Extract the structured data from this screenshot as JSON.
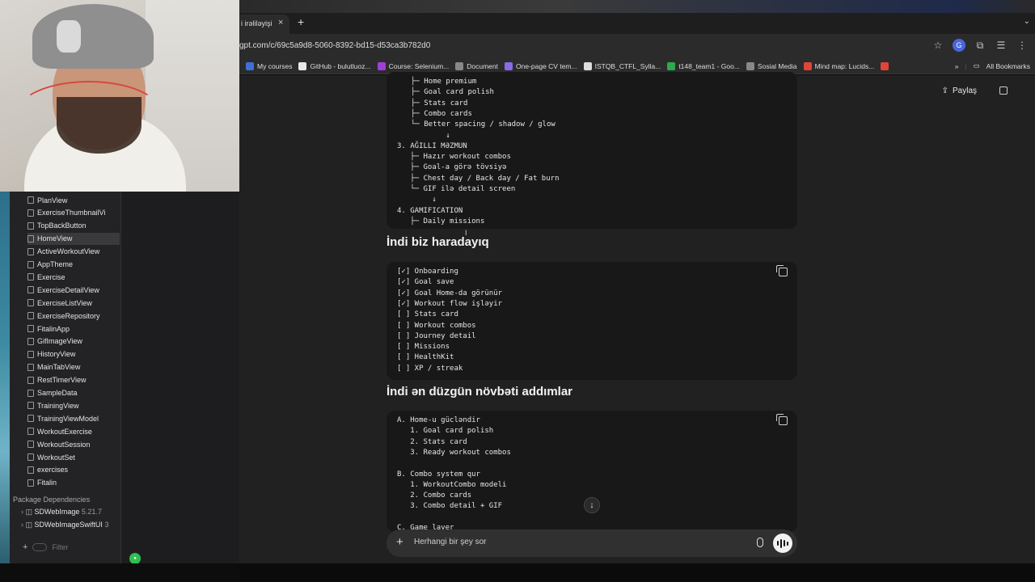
{
  "browser": {
    "tab": {
      "title": "i irəliləyişi",
      "close": "×",
      "new_tab": "+",
      "menu": "⌄"
    },
    "url": "gpt.com/c/69c5a9d8-5060-8392-bd15-d53ca3b782d0",
    "bookmarks": [
      {
        "label": "My courses",
        "color": "#3f6fd8"
      },
      {
        "label": "GitHub - bulutluoz...",
        "color": "#e8e8e8"
      },
      {
        "label": "Course: Selenium...",
        "color": "#a03fd8"
      },
      {
        "label": "Document",
        "color": "#888888"
      },
      {
        "label": "One-page CV tem...",
        "color": "#8a6be8"
      },
      {
        "label": "ISTQB_CTFL_Sylla...",
        "color": "#dddddd"
      },
      {
        "label": "t148_team1 - Goo...",
        "color": "#2fa84f"
      },
      {
        "label": "Sosial Media",
        "color": "#888888"
      },
      {
        "label": "Mind map: Lucids...",
        "color": "#e0453a"
      },
      {
        "label": "",
        "color": "#e0453a"
      }
    ],
    "bookmarks_more": "»",
    "all_bookmarks": "All Bookmarks"
  },
  "ide": {
    "files": [
      {
        "label": "PlanView"
      },
      {
        "label": "ExerciseThumbnailVi"
      },
      {
        "label": "TopBackButton"
      },
      {
        "label": "HomeView",
        "selected": true
      },
      {
        "label": "ActiveWorkoutView"
      },
      {
        "label": "AppTheme"
      },
      {
        "label": "Exercise"
      },
      {
        "label": "ExerciseDetailView"
      },
      {
        "label": "ExerciseListView"
      },
      {
        "label": "ExerciseRepository"
      },
      {
        "label": "FitalinApp"
      },
      {
        "label": "GifImageView"
      },
      {
        "label": "HistoryView"
      },
      {
        "label": "MainTabView"
      },
      {
        "label": "RestTimerView"
      },
      {
        "label": "SampleData"
      },
      {
        "label": "TrainingView"
      },
      {
        "label": "TrainingViewModel"
      },
      {
        "label": "WorkoutExercise"
      },
      {
        "label": "WorkoutSession"
      },
      {
        "label": "WorkoutSet"
      },
      {
        "label": "exercises"
      },
      {
        "label": "Fitalin"
      }
    ],
    "section_title": "Package Dependencies",
    "packages": [
      {
        "name": "SDWebImage",
        "version": "5.21.7"
      },
      {
        "name": "SDWebImageSwiftUI",
        "version": "3"
      }
    ],
    "filter_placeholder": "Filter"
  },
  "chat": {
    "share_label": "Paylaş",
    "block1_lines": [
      "├─ Home premium",
      "├─ Goal card polish",
      "├─ Stats card",
      "├─ Combo cards",
      "└─ Better spacing / shadow / glow",
      "        ↓",
      "3. AĞILLI MƏZMUN",
      "   ├─ Hazır workout combos",
      "   ├─ Goal-a görə tövsiyə",
      "   ├─ Chest day / Back day / Fat burn",
      "   └─ GIF ilə detail screen",
      "        ↓",
      "4. GAMIFICATION",
      "   ├─ Daily missions"
    ],
    "heading1": "İndi biz haradayıq",
    "block2_lines": [
      "[✓] Onboarding",
      "[✓] Goal save",
      "[✓] Goal Home-da görünür",
      "[✓] Workout flow işləyir",
      "[ ] Stats card",
      "[ ] Workout combos",
      "[ ] Journey detail",
      "[ ] Missions",
      "[ ] HealthKit",
      "[ ] XP / streak"
    ],
    "heading2": "İndi ən düzgün növbəti addımlar",
    "block3_lines": [
      "A. Home-u gücləndir",
      "   1. Goal card polish",
      "   2. Stats card",
      "   3. Ready workout combos",
      "",
      "B. Combo system qur",
      "   1. WorkoutCombo modeli",
      "   2. Combo cards",
      "   3. Combo detail + GIF",
      "",
      "C. Game layer"
    ],
    "scroll_down": "↓",
    "composer_placeholder": "Herhangi bir şey sor",
    "composer_plus": "+"
  }
}
